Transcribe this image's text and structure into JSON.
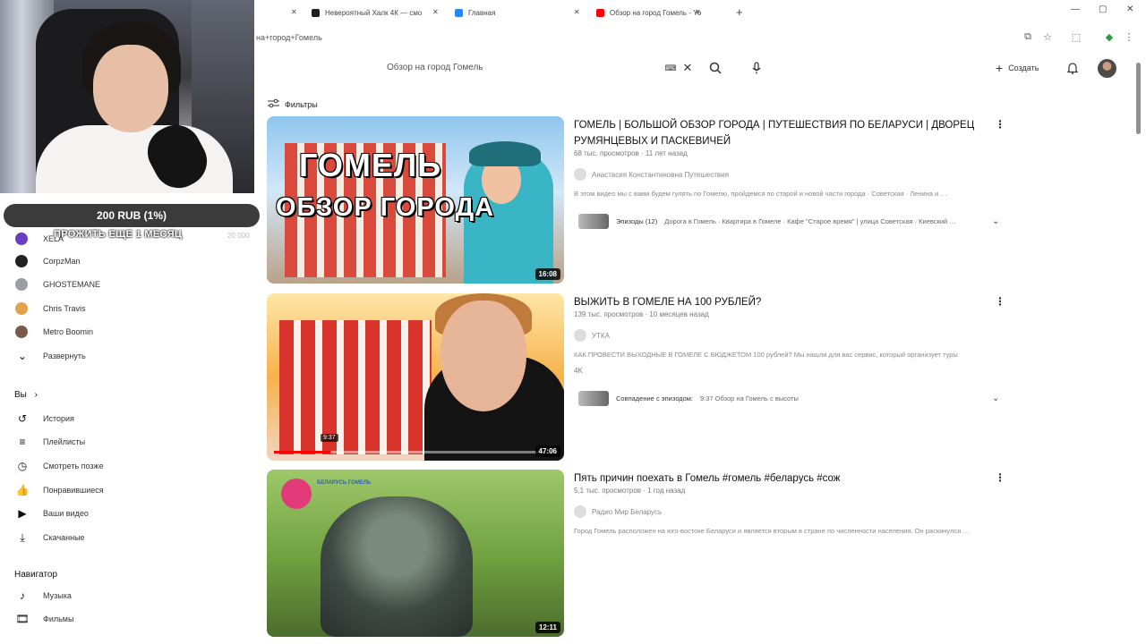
{
  "browser": {
    "tabs": [
      {
        "label": "Невероятный Халк 4К — смо",
        "color": "#1f1f1f"
      },
      {
        "label": "Главная",
        "color": "#2787f5"
      },
      {
        "label": "Обзор на город Гомель - Yo",
        "color": "#ff0000"
      }
    ],
    "url": "на+город+Гомель"
  },
  "stream_overlay": {
    "donation_label": "200 RUB (1%)",
    "donation_message": "ПРОЖИТЬ ЕЩЕ 1 МЕСЯЦ",
    "donation_amount": "20 000"
  },
  "sidebar": {
    "subscriptions": [
      {
        "label": "XELA",
        "color": "#6a3fbf"
      },
      {
        "label": "CorpzMan",
        "color": "#222222"
      },
      {
        "label": "GHOSTEMANE",
        "color": "#9aa0a6"
      },
      {
        "label": "Chris Travis",
        "color": "#e0a24a"
      },
      {
        "label": "Metro Boomin",
        "color": "#7a5b4a"
      }
    ],
    "expand_label": "Развернуть",
    "you_heading": "Вы",
    "you_items": [
      {
        "label": "История",
        "icon": "history-icon"
      },
      {
        "label": "Плейлисты",
        "icon": "playlists-icon"
      },
      {
        "label": "Смотреть позже",
        "icon": "watch-later-icon"
      },
      {
        "label": "Понравившиеся",
        "icon": "like-icon"
      },
      {
        "label": "Ваши видео",
        "icon": "your-videos-icon"
      },
      {
        "label": "Скачанные",
        "icon": "downloads-icon"
      }
    ],
    "navigator_heading": "Навигатор",
    "navigator_items": [
      {
        "label": "Музыка",
        "icon": "music-icon"
      },
      {
        "label": "Фильмы",
        "icon": "movies-icon"
      }
    ]
  },
  "header": {
    "search_query": "Обзор на город Гомель",
    "create_label": "Создать"
  },
  "filters_label": "Фильтры",
  "results": [
    {
      "title": "ГОМЕЛЬ | БОЛЬШОЙ ОБЗОР ГОРОДА | ПУТЕШЕСТВИЯ ПО БЕЛАРУСИ | ДВОРЕЦ РУМЯНЦЕВЫХ И ПАСКЕВИЧЕЙ",
      "meta": "68 тыс. просмотров · 11 лет назад",
      "channel": "Анастасия Константиновна Путешествия",
      "description": "В этом видео мы с вами будем гулять по Гомелю, пройдемся по старой и новой части города · Советская · Ленина и …",
      "episodes_label": "Эпизоды (12)",
      "episodes_list": "Дорога в Гомель · Квартира в Гомеле · Кафе \"Старое время\" | улица Советская · Киевский …",
      "duration": "16:08",
      "thumb_line1": "ГОМЕЛЬ",
      "thumb_line2": "ОБЗОР ГОРОДА"
    },
    {
      "title": "ВЫЖИТЬ В ГОМЕЛЕ НА 100 РУБЛЕЙ?",
      "meta": "139 тыс. просмотров · 10 месяцев назад",
      "channel": "УТКА",
      "description": "КАК ПРОВЕСТИ ВЫХОДНЫЕ В ГОМЕЛЕ С БЮДЖЕТОМ 100 рублей? Мы нашли для вас сервис, который организует туры",
      "badge": "4K",
      "match_label": "Совпадение с эпизодом:",
      "match_text": "9:37 Обзор на Гомель с высоты",
      "duration": "47:06",
      "progress_time": "9:37",
      "progress": 0.2
    },
    {
      "title": "Пять причин поехать в Гомель #гомель #беларусь #сож",
      "meta": "5,1 тыс. просмотров · 1 год назад",
      "channel": "Радио Мир Беларусь",
      "description": "Город Гомель расположен на юго-востоке Беларуси и является вторым в стране по численности населения. Он раскинулся …",
      "duration": "12:11",
      "thumb_tag": "БЕЛАРУСЬ ГОМЕЛЬ"
    }
  ]
}
